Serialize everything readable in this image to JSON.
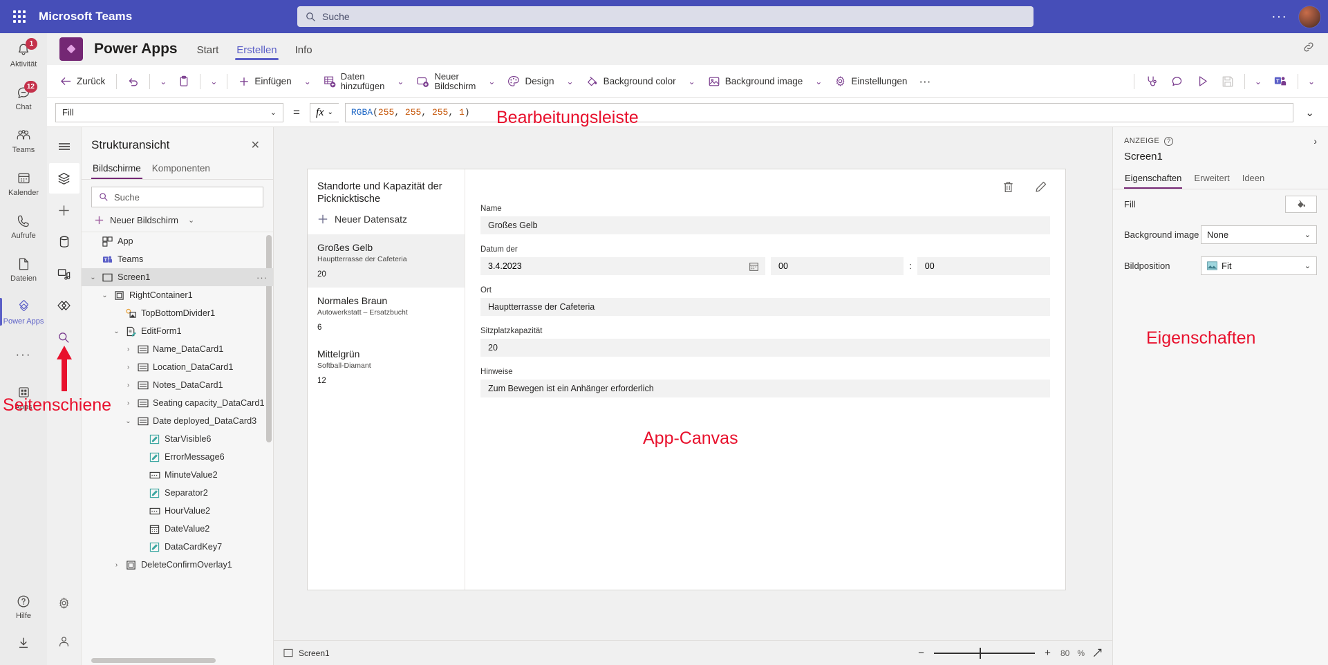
{
  "teams": {
    "app_title": "Microsoft Teams",
    "search_placeholder": "Suche",
    "waffle_icon": "app-launcher-icon",
    "more_icon": "more-horizontal-icon",
    "avatar_icon": "user-avatar",
    "rail": [
      {
        "label": "Aktivität",
        "icon": "bell-icon",
        "badge": "1",
        "selected": false
      },
      {
        "label": "Chat",
        "icon": "chat-icon",
        "badge": "12",
        "selected": false
      },
      {
        "label": "Teams",
        "icon": "people-icon",
        "badge": "",
        "selected": false
      },
      {
        "label": "Kalender",
        "icon": "calendar-icon",
        "badge": "",
        "selected": false
      },
      {
        "label": "Aufrufe",
        "icon": "phone-icon",
        "badge": "",
        "selected": false
      },
      {
        "label": "Dateien",
        "icon": "file-icon",
        "badge": "",
        "selected": false
      },
      {
        "label": "Power Apps",
        "icon": "powerapps-icon",
        "badge": "",
        "selected": true
      },
      {
        "label": "",
        "icon": "more-dots-icon",
        "badge": "",
        "selected": false
      },
      {
        "label": "Apps",
        "icon": "apps-grid-icon",
        "badge": "",
        "selected": false
      }
    ],
    "rail_bottom": [
      {
        "label": "Hilfe",
        "icon": "help-circle-icon"
      },
      {
        "label": "",
        "icon": "download-icon"
      }
    ]
  },
  "powerapps": {
    "name": "Power Apps",
    "logo_icon": "powerapps-logo",
    "tabs": [
      {
        "label": "Start",
        "selected": false
      },
      {
        "label": "Erstellen",
        "selected": true
      },
      {
        "label": "Info",
        "selected": false
      }
    ],
    "header_right_icon": "link-icon"
  },
  "toolbar": {
    "back": "Zurück",
    "back_icon": "arrow-left-icon",
    "undo_icon": "undo-icon",
    "redo_chevron_icon": "chevron-down-icon",
    "paste_icon": "clipboard-icon",
    "paste_chevron_icon": "chevron-down-icon",
    "insert": "Einfügen",
    "insert_icon": "plus-icon",
    "insert_chevron_icon": "chevron-down-icon",
    "add_data_line1": "Daten",
    "add_data_line2": "hinzufügen",
    "add_data_icon": "database-add-icon",
    "add_data_chevron_icon": "chevron-down-icon",
    "new_screen_line1": "Neuer",
    "new_screen_line2": "Bildschirm",
    "new_screen_icon": "new-screen-icon",
    "new_screen_chevron_icon": "chevron-down-icon",
    "theme": "Design",
    "theme_icon": "palette-icon",
    "theme_chevron_icon": "chevron-down-icon",
    "bg_color": "Background color",
    "bg_color_icon": "paint-bucket-icon",
    "bg_color_chevron_icon": "chevron-down-icon",
    "bg_image": "Background image",
    "bg_image_icon": "image-icon",
    "bg_image_chevron_icon": "chevron-down-icon",
    "settings": "Einstellungen",
    "settings_icon": "gear-icon",
    "overflow_icon": "more-horizontal-icon",
    "right_icons": [
      {
        "name": "app-checker-icon"
      },
      {
        "name": "comments-icon"
      },
      {
        "name": "preview-play-icon"
      },
      {
        "name": "save-icon"
      },
      {
        "name": "chevron-down-icon"
      },
      {
        "name": "publish-teams-icon"
      },
      {
        "name": "chevron-down-icon"
      }
    ]
  },
  "formula_bar": {
    "property": "Fill",
    "property_chevron_icon": "chevron-down-icon",
    "equals": "=",
    "fx_label": "fx",
    "fx_chevron_icon": "chevron-down-icon",
    "formula_fn": "RGBA",
    "formula_open": "(",
    "formula_args": [
      "255",
      "255",
      "255",
      "1"
    ],
    "formula_close": ")",
    "expand_chevron_icon": "chevron-down-icon"
  },
  "side_rail": [
    {
      "icon": "hamburger-menu-icon",
      "selected": false
    },
    {
      "icon": "layers-tree-icon",
      "selected": true
    },
    {
      "icon": "insert-plus-icon",
      "selected": false
    },
    {
      "icon": "data-cylinder-icon",
      "selected": false
    },
    {
      "icon": "media-icon",
      "selected": false
    },
    {
      "icon": "power-automate-icon",
      "selected": false
    },
    {
      "icon": "search-icon",
      "selected": false
    }
  ],
  "side_rail_bottom": [
    {
      "icon": "gear-icon"
    },
    {
      "icon": "person-feedback-icon"
    }
  ],
  "tree_panel": {
    "title": "Strukturansicht",
    "close_icon": "close-icon",
    "tabs": [
      {
        "label": "Bildschirme",
        "selected": true
      },
      {
        "label": "Komponenten",
        "selected": false
      }
    ],
    "search_placeholder": "Suche",
    "search_icon": "search-icon",
    "new_screen": "Neuer Bildschirm",
    "new_screen_icon": "plus-icon",
    "new_screen_chevron_icon": "chevron-down-icon",
    "nodes": [
      {
        "label": "App",
        "icon": "app-icon",
        "indent": 0,
        "twisty": "",
        "selected": false,
        "dots": false
      },
      {
        "label": "Teams",
        "icon": "teams-icon",
        "indent": 0,
        "twisty": "",
        "selected": false,
        "dots": false
      },
      {
        "label": "Screen1",
        "icon": "screen-icon",
        "indent": 0,
        "twisty": "expanded",
        "selected": true,
        "dots": true
      },
      {
        "label": "RightContainer1",
        "icon": "container-icon",
        "indent": 1,
        "twisty": "expanded",
        "selected": false,
        "dots": false
      },
      {
        "label": "TopBottomDivider1",
        "icon": "divider-icon",
        "indent": 2,
        "twisty": "",
        "selected": false,
        "dots": false
      },
      {
        "label": "EditForm1",
        "icon": "form-icon",
        "indent": 2,
        "twisty": "expanded",
        "selected": false,
        "dots": false
      },
      {
        "label": "Name_DataCard1",
        "icon": "datacard-icon",
        "indent": 3,
        "twisty": "collapsed",
        "selected": false,
        "dots": false
      },
      {
        "label": "Location_DataCard1",
        "icon": "datacard-icon",
        "indent": 3,
        "twisty": "collapsed",
        "selected": false,
        "dots": false
      },
      {
        "label": "Notes_DataCard1",
        "icon": "datacard-icon",
        "indent": 3,
        "twisty": "collapsed",
        "selected": false,
        "dots": false
      },
      {
        "label": "Seating capacity_DataCard1",
        "icon": "datacard-icon",
        "indent": 3,
        "twisty": "collapsed",
        "selected": false,
        "dots": false
      },
      {
        "label": "Date deployed_DataCard3",
        "icon": "datacard-icon",
        "indent": 3,
        "twisty": "expanded",
        "selected": false,
        "dots": false
      },
      {
        "label": "StarVisible6",
        "icon": "label-edit-icon",
        "indent": 4,
        "twisty": "",
        "selected": false,
        "dots": false
      },
      {
        "label": "ErrorMessage6",
        "icon": "label-edit-icon",
        "indent": 4,
        "twisty": "",
        "selected": false,
        "dots": false
      },
      {
        "label": "MinuteValue2",
        "icon": "dropdown-icon",
        "indent": 4,
        "twisty": "",
        "selected": false,
        "dots": false
      },
      {
        "label": "Separator2",
        "icon": "label-edit-icon",
        "indent": 4,
        "twisty": "",
        "selected": false,
        "dots": false
      },
      {
        "label": "HourValue2",
        "icon": "dropdown-icon",
        "indent": 4,
        "twisty": "",
        "selected": false,
        "dots": false
      },
      {
        "label": "DateValue2",
        "icon": "calendar-icon",
        "indent": 4,
        "twisty": "",
        "selected": false,
        "dots": false
      },
      {
        "label": "DataCardKey7",
        "icon": "label-edit-icon",
        "indent": 4,
        "twisty": "",
        "selected": false,
        "dots": false
      },
      {
        "label": "DeleteConfirmOverlay1",
        "icon": "container-icon",
        "indent": 2,
        "twisty": "collapsed",
        "selected": false,
        "dots": false
      }
    ]
  },
  "app_canvas": {
    "gallery": {
      "title": "Standorte und Kapazität der Picknicktische",
      "new_record": "Neuer Datensatz",
      "new_record_icon": "plus-icon",
      "items": [
        {
          "name": "Großes Gelb",
          "location": "Hauptterrasse der Cafeteria",
          "capacity": "20",
          "selected": true
        },
        {
          "name": "Normales Braun",
          "location": "Autowerkstatt – Ersatzbucht",
          "capacity": "6",
          "selected": false
        },
        {
          "name": "Mittelgrün",
          "location": "Softball-Diamant",
          "capacity": "12",
          "selected": false
        }
      ]
    },
    "form": {
      "delete_icon": "trash-icon",
      "edit_icon": "pencil-icon",
      "fields": [
        {
          "label": "Name",
          "value": "Großes Gelb",
          "type": "text"
        },
        {
          "label": "Datum der",
          "value": "3.4.2023",
          "hour": "00",
          "minute": "00",
          "separator": ":",
          "type": "datetime",
          "calendar_icon": "calendar-icon"
        },
        {
          "label": "Ort",
          "value": "Hauptterrasse der Cafeteria",
          "type": "text"
        },
        {
          "label": "Sitzplatzkapazität",
          "value": "20",
          "type": "text"
        },
        {
          "label": "Hinweise",
          "value": "Zum Bewegen ist ein Anhänger erforderlich",
          "type": "text"
        }
      ]
    }
  },
  "properties": {
    "category": "ANZEIGE",
    "help_icon": "help-circle-icon",
    "collapse_icon": "chevron-right-icon",
    "selected_control": "Screen1",
    "tabs": [
      {
        "label": "Eigenschaften",
        "selected": true
      },
      {
        "label": "Erweitert",
        "selected": false
      },
      {
        "label": "Ideen",
        "selected": false
      }
    ],
    "rows": [
      {
        "label": "Fill",
        "value": "",
        "type": "swatch",
        "icon": "paint-bucket-icon"
      },
      {
        "label": "Background image",
        "value": "None",
        "type": "dropdown",
        "icon": ""
      },
      {
        "label": "Bildposition",
        "value": "Fit",
        "type": "dropdown",
        "icon": "image-icon"
      }
    ]
  },
  "status_bar": {
    "screen_name": "Screen1",
    "screen_icon": "screen-icon",
    "zoom_out_icon": "minus-icon",
    "zoom_in_icon": "plus-icon",
    "zoom_value": "80",
    "zoom_unit": "%",
    "fit_icon": "fit-screen-icon"
  },
  "annotations": {
    "formula_bar": "Bearbeitungsleiste",
    "canvas": "App-Canvas",
    "properties": "Eigenschaften",
    "side_rail": "Seitenschiene",
    "color": "#e8112d"
  }
}
